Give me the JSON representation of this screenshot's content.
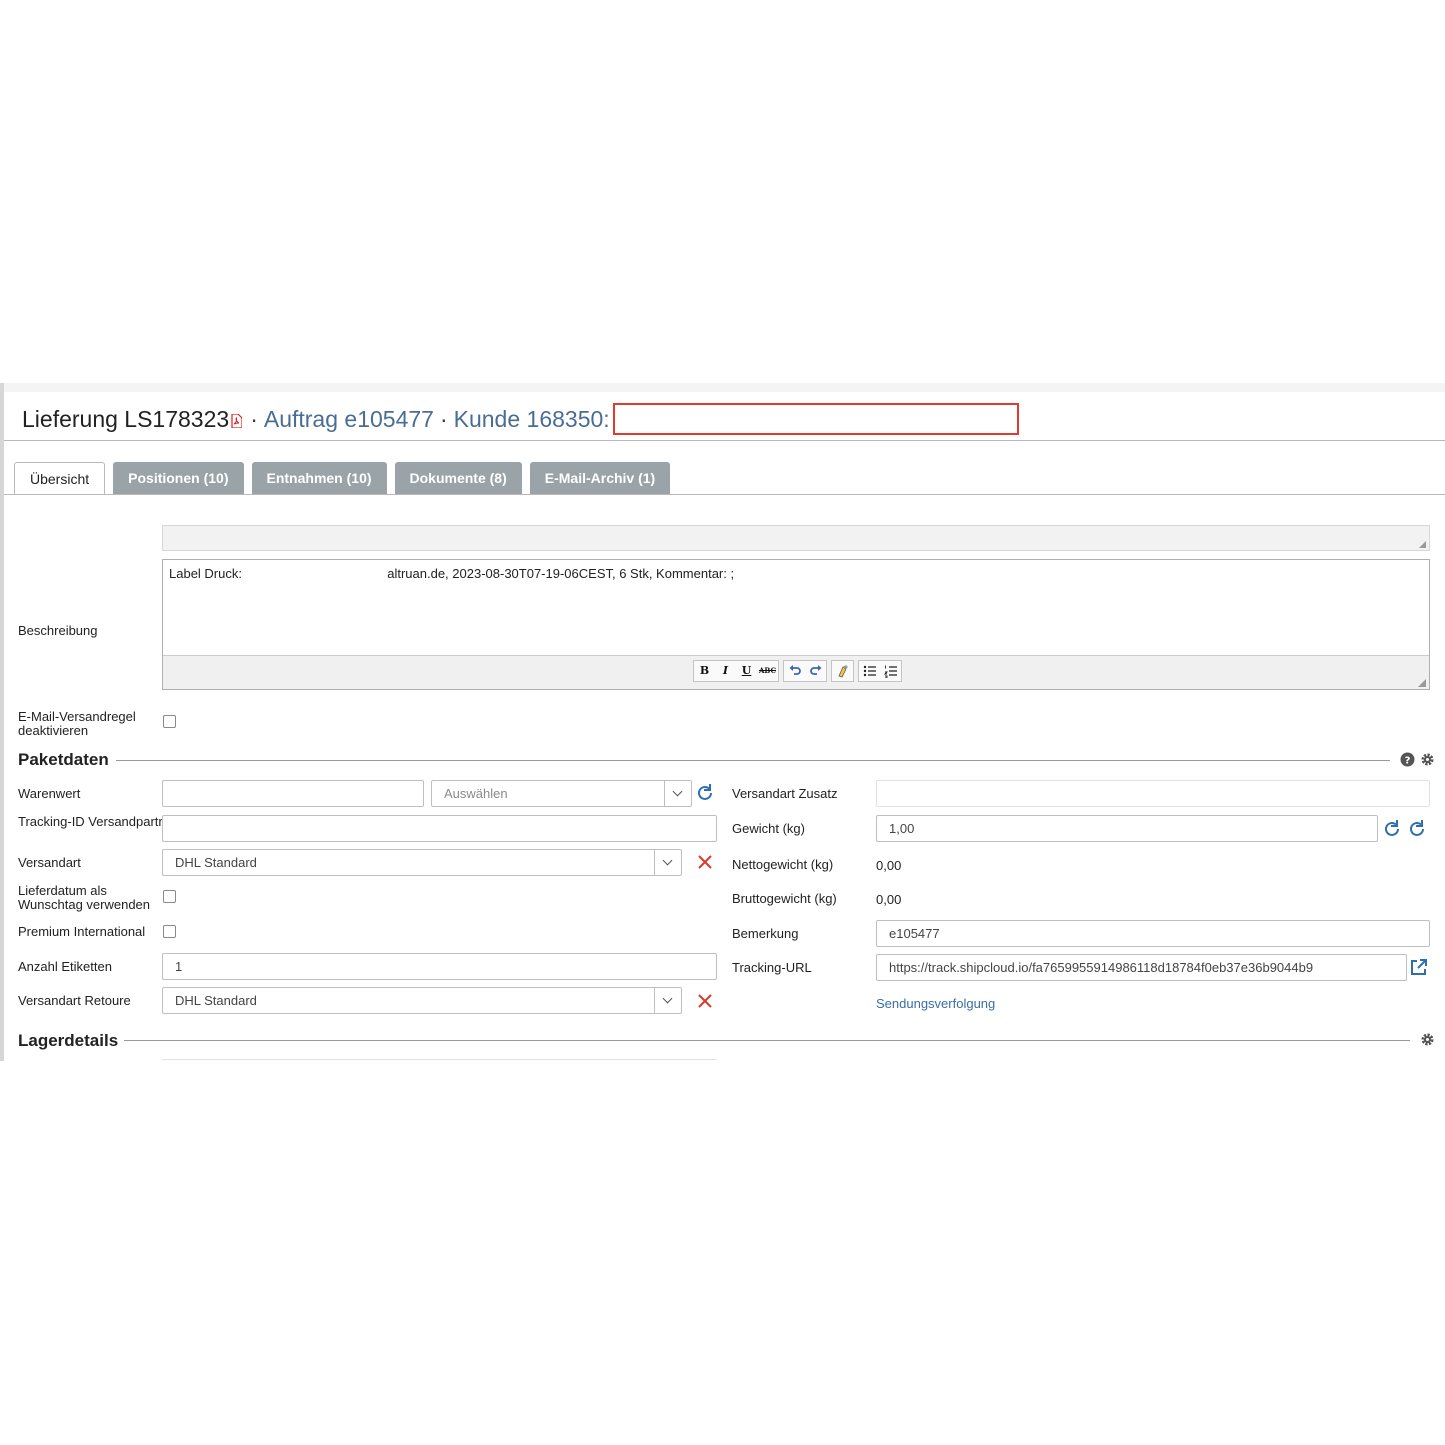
{
  "header": {
    "title": "Lieferung LS178323",
    "sep1": "·",
    "order_link": "Auftrag e105477",
    "sep2": "·",
    "customer_link": "Kunde 168350:"
  },
  "tabs": [
    {
      "label": "Übersicht",
      "active": true
    },
    {
      "label": "Positionen (10)"
    },
    {
      "label": "Entnahmen (10)"
    },
    {
      "label": "Dokumente (8)"
    },
    {
      "label": "E-Mail-Archiv (1)"
    }
  ],
  "description": {
    "label": "Beschreibung",
    "text_prefix": "Label Druck:",
    "text_rest": "altruan.de, 2023-08-30T07-19-06CEST, 6 Stk, Kommentar: ;",
    "toolbar": [
      "B",
      "I",
      "U",
      "ABC"
    ]
  },
  "email_rule": {
    "label": "E-Mail-Versandregel deaktivieren",
    "checked": false
  },
  "paketdaten": {
    "title": "Paketdaten",
    "warenwert": {
      "label": "Warenwert",
      "value": "",
      "currency_placeholder": "Auswählen"
    },
    "tracking_id": {
      "label": "Tracking-ID Versandpartner",
      "value": ""
    },
    "versandart": {
      "label": "Versandart",
      "value": "DHL Standard"
    },
    "lieferdatum": {
      "label": "Lieferdatum als Wunschtag verwenden",
      "checked": false
    },
    "premium": {
      "label": "Premium International",
      "checked": false
    },
    "anzahl": {
      "label": "Anzahl Etiketten",
      "value": "1"
    },
    "versandart_retoure": {
      "label": "Versandart Retoure",
      "value": "DHL Standard"
    },
    "versandart_zusatz": {
      "label": "Versandart Zusatz",
      "value": ""
    },
    "gewicht": {
      "label": "Gewicht (kg)",
      "value": "1,00"
    },
    "netto": {
      "label": "Nettogewicht (kg)",
      "value": "0,00"
    },
    "brutto": {
      "label": "Bruttogewicht (kg)",
      "value": "0,00"
    },
    "bemerkung": {
      "label": "Bemerkung",
      "value": "e105477"
    },
    "tracking_url": {
      "label": "Tracking-URL",
      "value": "https://track.shipcloud.io/fa7659955914986118d18784f0eb37e36b9044b9"
    },
    "sendungsverfolgung": "Sendungsverfolgung"
  },
  "lagerdetails": {
    "title": "Lagerdetails"
  },
  "colors": {
    "link": "#4a6d96",
    "accent_blue": "#3a6ea5",
    "danger": "#d83a2e",
    "tab_inactive": "#9aa3a8"
  }
}
